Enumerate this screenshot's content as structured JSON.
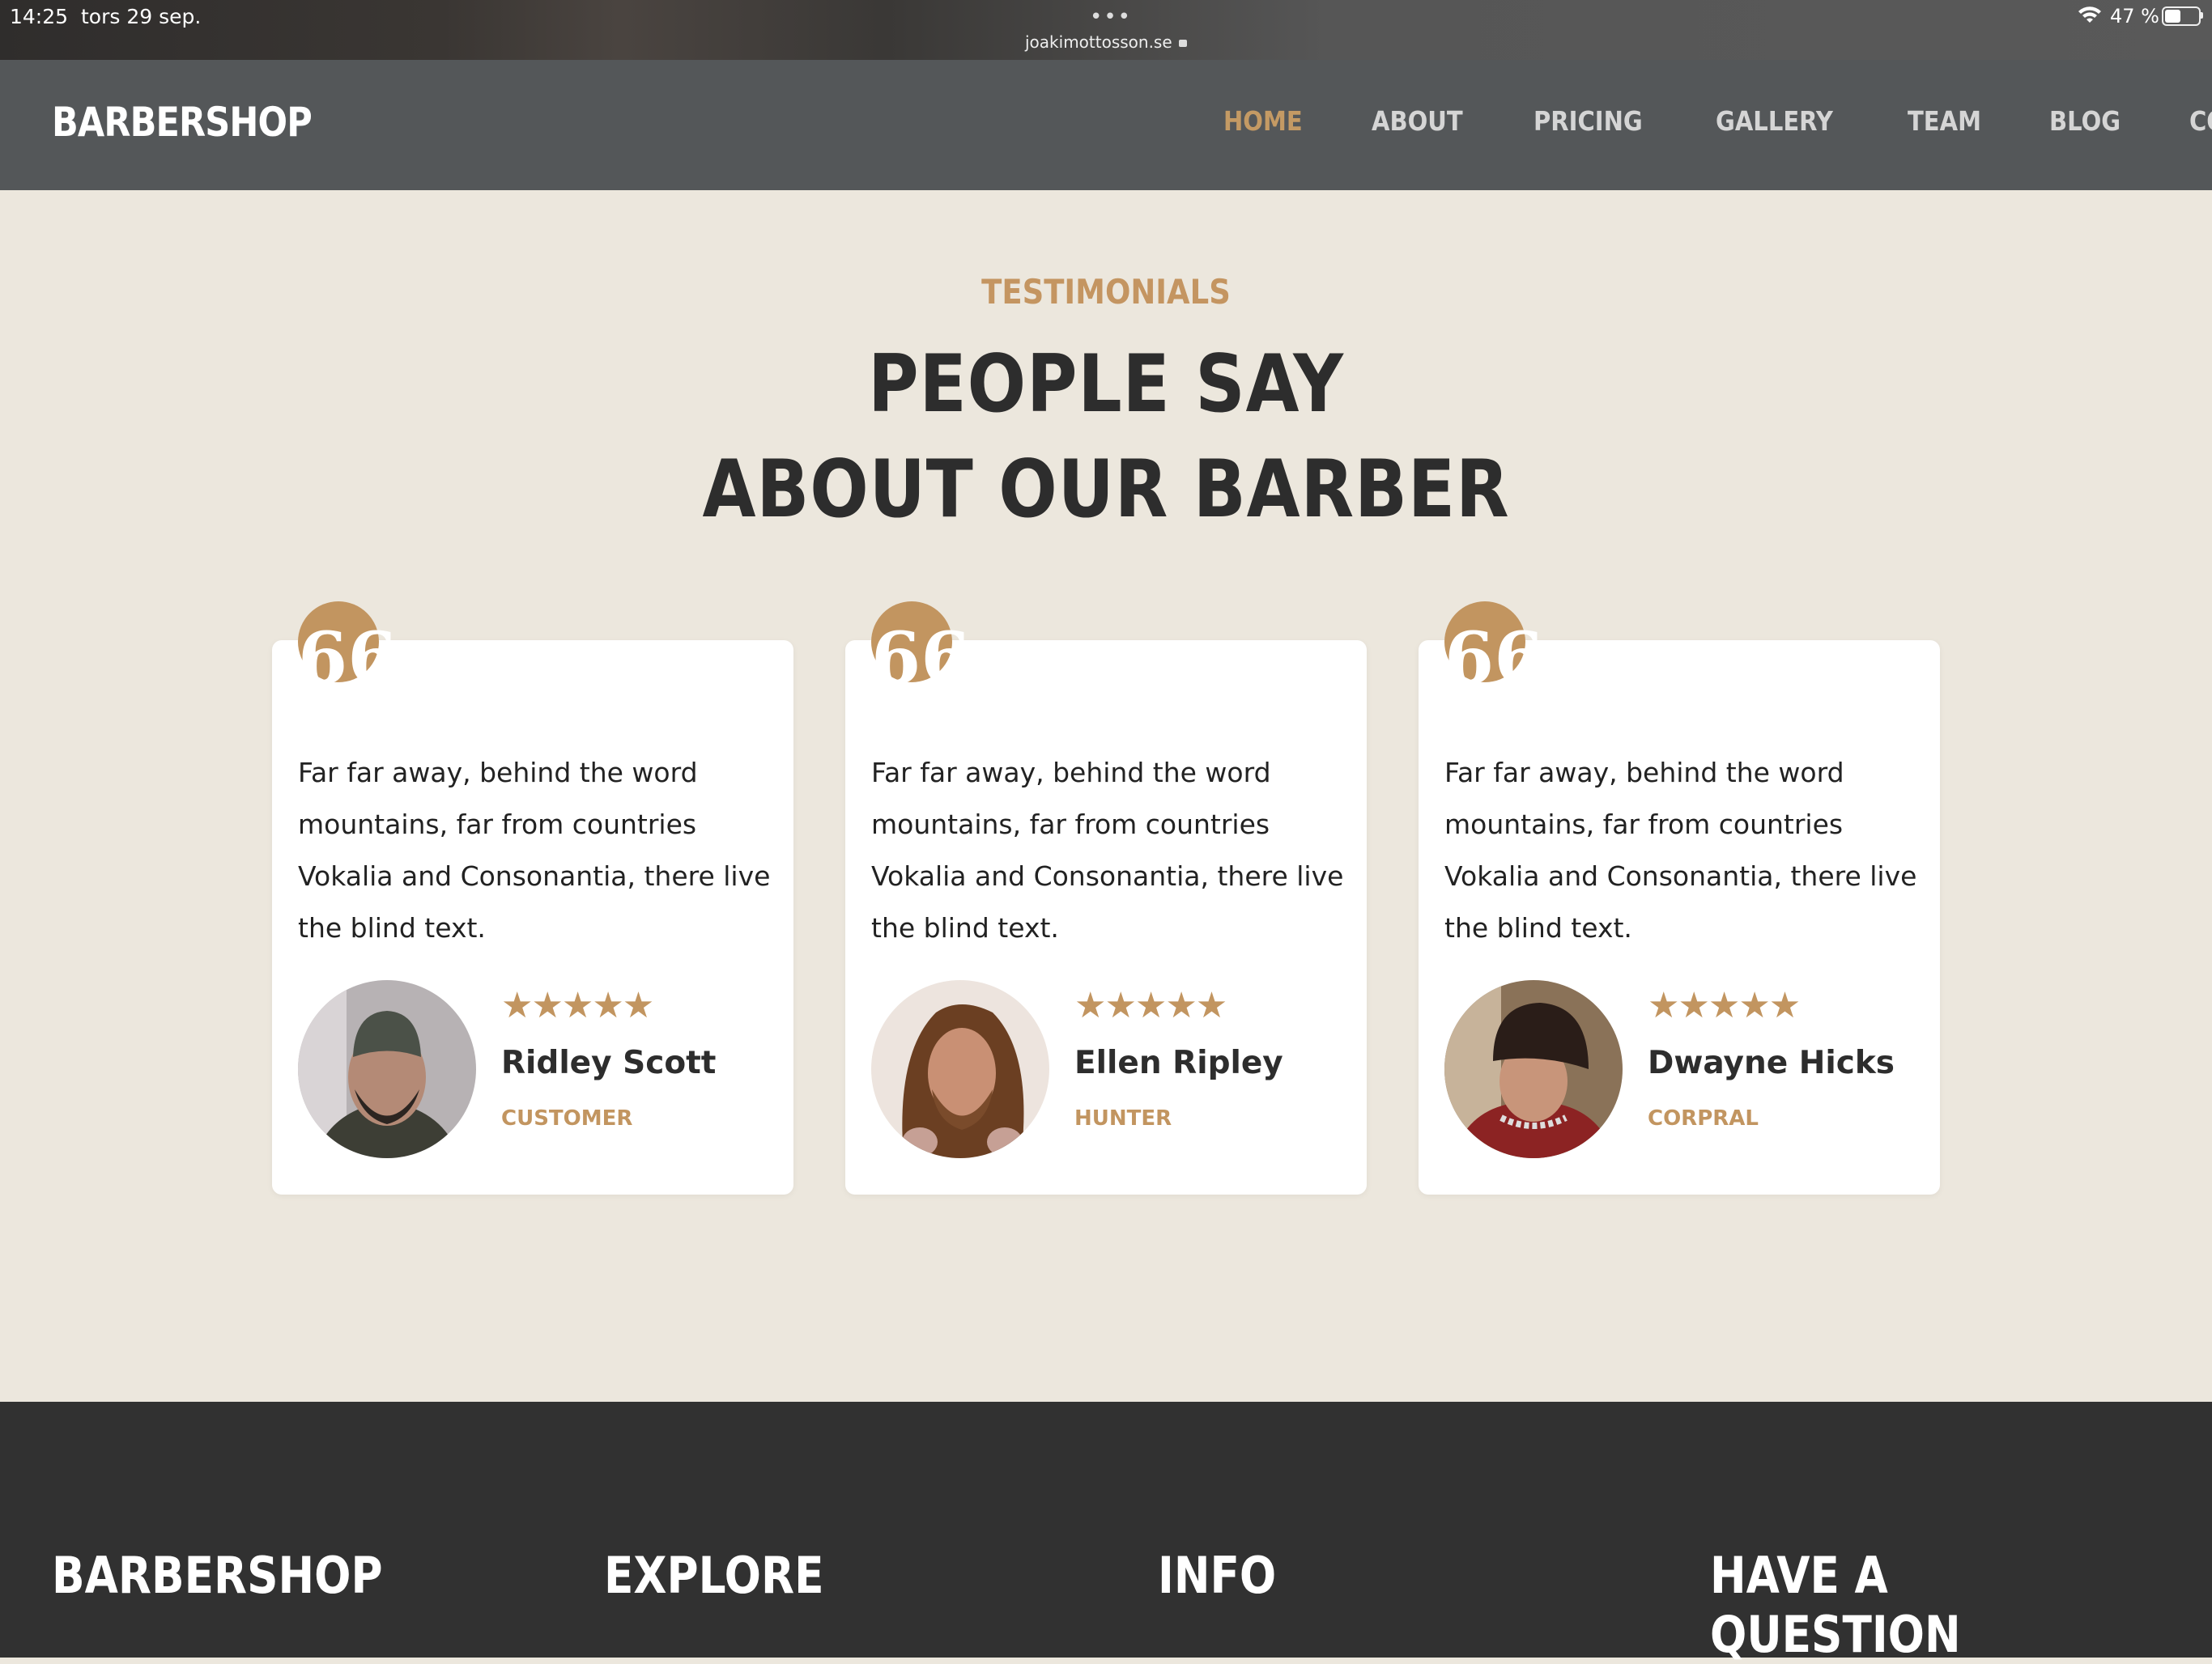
{
  "status_bar": {
    "time": "14:25",
    "date": "tors 29 sep.",
    "dots": "•••",
    "url": "joakimottosson.se",
    "battery": "47 %"
  },
  "nav": {
    "brand": "BARBERSHOP",
    "items": [
      {
        "label": "HOME",
        "active": true
      },
      {
        "label": "ABOUT"
      },
      {
        "label": "PRICING"
      },
      {
        "label": "GALLERY"
      },
      {
        "label": "TEAM"
      },
      {
        "label": "BLOG"
      },
      {
        "label": "CONTACT"
      }
    ]
  },
  "testimonials": {
    "subtitle": "TESTIMONIALS",
    "headline_line1": "PEOPLE SAY",
    "headline_line2": "ABOUT OUR BARBER",
    "cards": [
      {
        "quote_icon": "66",
        "text": "Far far away, behind the word mountains, far from countries Vokalia and Consonantia, there live the blind text.",
        "stars": "★★★★★",
        "rating": 5,
        "name": "Ridley Scott",
        "role": "CUSTOMER"
      },
      {
        "quote_icon": "66",
        "text": "Far far away, behind the word mountains, far from countries Vokalia and Consonantia, there live the blind text.",
        "stars": "★★★★★",
        "rating": 5,
        "name": "Ellen Ripley",
        "role": "HUNTER"
      },
      {
        "quote_icon": "66",
        "text": "Far far away, behind the word mountains, far from countries Vokalia and Consonantia, there live the blind text.",
        "stars": "★★★★★",
        "rating": 5,
        "name": "Dwayne Hicks",
        "role": "CORPRAL"
      }
    ]
  },
  "footer": {
    "columns": [
      "BARBERSHOP",
      "EXPLORE",
      "INFO",
      "HAVE A QUESTION"
    ]
  },
  "colors": {
    "accent": "#c29560",
    "nav_bg": "#545759",
    "page_bg": "#ece7dd",
    "footer_bg": "#313131",
    "heading": "#2d2d2d"
  }
}
